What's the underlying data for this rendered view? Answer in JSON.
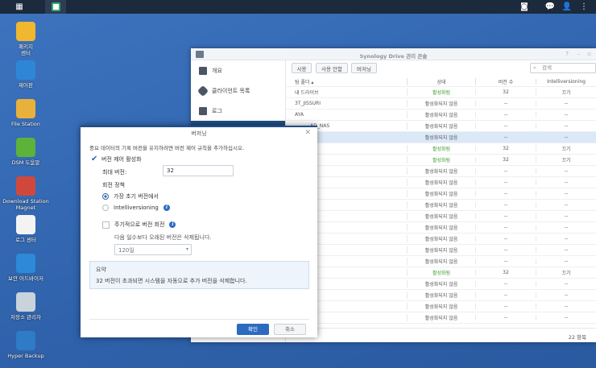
{
  "desktop": {
    "icons": [
      {
        "label": "패키지\n센터",
        "icon": "package-center-icon",
        "color": "#f0b72f"
      },
      {
        "label": "제어판",
        "icon": "control-panel-icon",
        "color": "#2f86d6"
      },
      {
        "label": "File Station",
        "icon": "file-station-icon",
        "color": "#e8b13b"
      },
      {
        "label": "DSM 도움말",
        "icon": "help-icon",
        "color": "#5bb33a"
      },
      {
        "label": "Download Station\nMagnet",
        "icon": "magnet-icon",
        "color": "#d0483c"
      },
      {
        "label": "로그 센터",
        "icon": "log-center-icon",
        "color": "#f3f3f3"
      },
      {
        "label": "보안 어드바이저",
        "icon": "security-advisor-icon",
        "color": "#2c8ad8"
      },
      {
        "label": "저장소 관리자",
        "icon": "storage-manager-icon",
        "color": "#c9d3dc"
      },
      {
        "label": "Hyper Backup",
        "icon": "hyper-backup-icon",
        "color": "#2e7bc7"
      }
    ]
  },
  "window": {
    "title": "Synology Drive 관리 콘솔",
    "sidebar": [
      "개요",
      "클라이언트 목록",
      "로그"
    ],
    "toolbar": {
      "enable": "사용",
      "disable": "사용 안함",
      "versioning": "버저닝",
      "search_placeholder": "검색"
    },
    "columns": [
      "팀 폴더 ▴",
      "상태",
      "버전 수",
      "Intelliversioning"
    ],
    "rows": [
      {
        "name": "내 드라이브",
        "status": "활성화됨",
        "on": true,
        "versions": "32",
        "intelli": "끄기"
      },
      {
        "name": "3T_JISSURI",
        "status": "활성화되지 않음",
        "on": false,
        "versions": "--",
        "intelli": "--"
      },
      {
        "name": "AYA",
        "status": "활성화되지 않음",
        "on": false,
        "versions": "--",
        "intelli": "--"
      },
      {
        "name": "AD_NAS",
        "status": "활성화되지 않음",
        "on": false,
        "versions": "--",
        "intelli": "--"
      },
      {
        "name": "",
        "status": "활성화되지 않음",
        "on": false,
        "versions": "--",
        "intelli": "--",
        "selected": true
      },
      {
        "name": "",
        "status": "활성화됨",
        "on": true,
        "versions": "32",
        "intelli": "끄기"
      },
      {
        "name": "",
        "status": "활성화됨",
        "on": true,
        "versions": "32",
        "intelli": "끄기"
      },
      {
        "name": "",
        "status": "활성화되지 않음",
        "on": false,
        "versions": "--",
        "intelli": "--"
      },
      {
        "name": "C",
        "status": "활성화되지 않음",
        "on": false,
        "versions": "--",
        "intelli": "--"
      },
      {
        "name": "",
        "status": "활성화되지 않음",
        "on": false,
        "versions": "--",
        "intelli": "--"
      },
      {
        "name": "o",
        "status": "활성화되지 않음",
        "on": false,
        "versions": "--",
        "intelli": "--"
      },
      {
        "name": "",
        "status": "활성화되지 않음",
        "on": false,
        "versions": "--",
        "intelli": "--"
      },
      {
        "name": "",
        "status": "활성화되지 않음",
        "on": false,
        "versions": "--",
        "intelli": "--"
      },
      {
        "name": "",
        "status": "활성화되지 않음",
        "on": false,
        "versions": "--",
        "intelli": "--"
      },
      {
        "name": "",
        "status": "활성화되지 않음",
        "on": false,
        "versions": "--",
        "intelli": "--"
      },
      {
        "name": "",
        "status": "활성화되지 않음",
        "on": false,
        "versions": "--",
        "intelli": "--"
      },
      {
        "name": "",
        "status": "활성화됨",
        "on": true,
        "versions": "32",
        "intelli": "끄기"
      },
      {
        "name": "",
        "status": "활성화되지 않음",
        "on": false,
        "versions": "--",
        "intelli": "--"
      },
      {
        "name": "",
        "status": "활성화되지 않음",
        "on": false,
        "versions": "--",
        "intelli": "--"
      },
      {
        "name": "",
        "status": "활성화되지 않음",
        "on": false,
        "versions": "--",
        "intelli": "--"
      },
      {
        "name": "",
        "status": "활성화되지 않음",
        "on": false,
        "versions": "--",
        "intelli": "--"
      }
    ],
    "footer": "22 항목"
  },
  "dialog": {
    "title": "버저닝",
    "description": "중요 데이터의 기록 버전을 유지하려면 버전 제어 규칙을 추가하십시오.",
    "enable_label": "버전 제어 활성화",
    "max_versions_label": "최대 버전:",
    "max_versions_value": "32",
    "rotation_label": "회전 정책",
    "option_earliest": "가장 초기 버전에서",
    "option_intelli": "Intelliversioning",
    "periodic_label": "주기적으로 버전 회전",
    "periodic_desc": "다음 일수보다 오래된 버전은 삭제됩니다.",
    "days_value": "120일",
    "summary_title": "요약",
    "summary_text": "32 버전이 초과되면 시스템을 자동으로 추가 버전을 삭제합니다.",
    "ok": "확인",
    "cancel": "취소"
  }
}
